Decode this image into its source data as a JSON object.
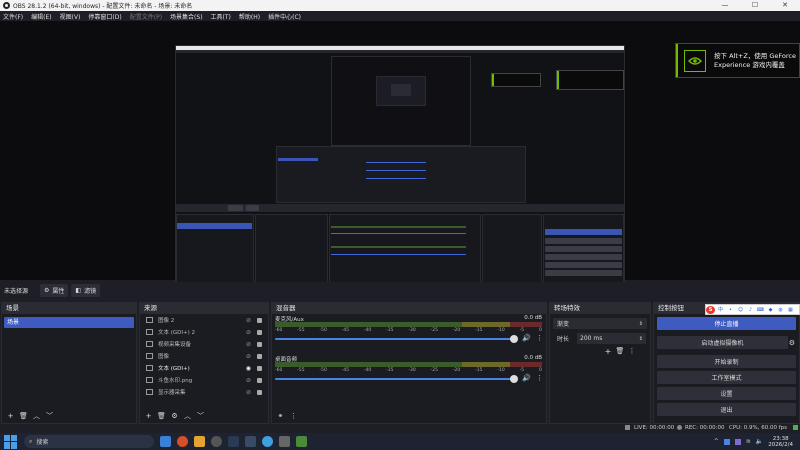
{
  "window": {
    "title": "OBS 28.1.2 (64-bit, windows) - 配置文件: 未命名 - 场景: 未命名",
    "minimize": "—",
    "maximize": "☐",
    "close": "✕"
  },
  "menu": [
    {
      "label": "文件(F)",
      "enabled": true
    },
    {
      "label": "编辑(E)",
      "enabled": true
    },
    {
      "label": "视图(V)",
      "enabled": true
    },
    {
      "label": "停靠窗口(D)",
      "enabled": true
    },
    {
      "label": "配置文件(P)",
      "enabled": false
    },
    {
      "label": "场景集合(S)",
      "enabled": true
    },
    {
      "label": "工具(T)",
      "enabled": true
    },
    {
      "label": "帮助(H)",
      "enabled": true
    },
    {
      "label": "插件中心(C)",
      "enabled": true
    }
  ],
  "preview": {
    "notification": {
      "line1": "按下 Alt+Z，使用 GeForce",
      "line2": "Experience 游戏内覆盖"
    }
  },
  "scene_bar": {
    "label": "未选择源",
    "properties_label": "属性",
    "filters_label": "滤镜"
  },
  "scenes": {
    "header": "场景",
    "items": [
      "场景"
    ]
  },
  "sources": {
    "header": "来源",
    "items": [
      {
        "label": "图像 2",
        "icon": "image-icon"
      },
      {
        "label": "文本 (GDI+) 2",
        "icon": "text-icon"
      },
      {
        "label": "视频采集设备",
        "icon": "camera-icon"
      },
      {
        "label": "图像",
        "icon": "image-icon"
      },
      {
        "label": "文本 (GDI+)",
        "icon": "text-icon"
      },
      {
        "label": "斗鱼水印.png",
        "icon": "image-icon"
      },
      {
        "label": "显示器采集",
        "icon": "monitor-icon"
      }
    ]
  },
  "mixer": {
    "header": "混音器",
    "channels": [
      {
        "name": "麦克风/Aux",
        "db": "0.0 dB"
      },
      {
        "name": "桌面音频",
        "db": "0.0 dB"
      }
    ],
    "ticks": [
      "-60",
      "-55",
      "-50",
      "-45",
      "-40",
      "-35",
      "-30",
      "-25",
      "-20",
      "-15",
      "-10",
      "-5",
      "0"
    ]
  },
  "transitions": {
    "header": "转场特效",
    "selected": "渐变",
    "duration_label": "时长",
    "duration_value": "200 ms"
  },
  "controls": {
    "header": "控制按钮",
    "buttons": [
      "停止直播",
      "启动虚拟摄像机",
      "开始录制",
      "工作室模式",
      "设置",
      "退出"
    ]
  },
  "status": {
    "live": "LIVE: 00:00:00",
    "rec": "REC: 00:00:00",
    "cpu": "CPU: 0.9%, 60.00 fps"
  },
  "taskbar": {
    "search_placeholder": "搜索",
    "time": "23:38",
    "date": "2026/2/4"
  },
  "colors": {
    "accent_blue": "#3e5bbf",
    "nvidia_green": "#76b900",
    "panel_bg": "#1b1c22"
  }
}
